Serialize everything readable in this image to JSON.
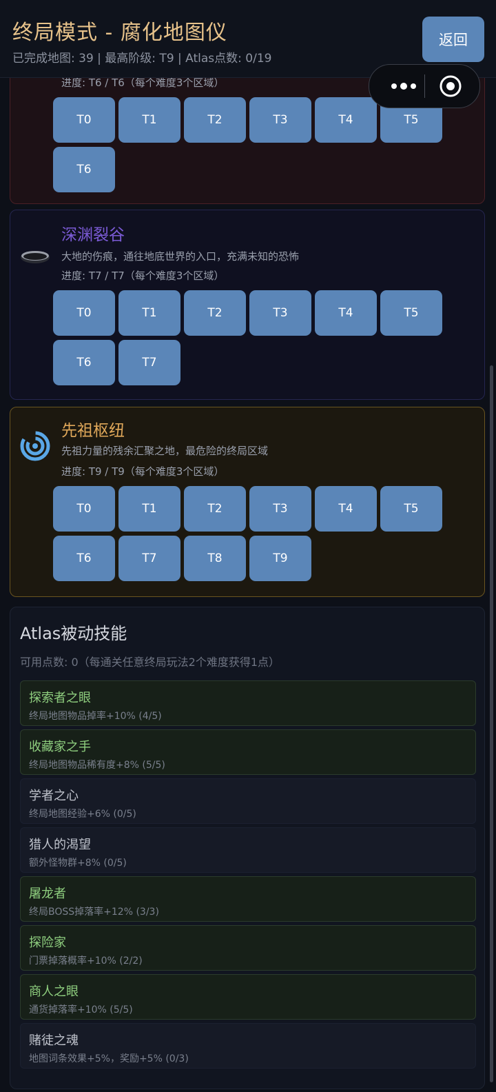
{
  "header": {
    "title": "终局模式 - 腐化地图仪",
    "subtitle": "已完成地图: 39 | 最高阶级: T9 | Atlas点数: 0/19",
    "back_label": "返回"
  },
  "regions": [
    {
      "name": "",
      "description": "",
      "progress": "进度: T6 / T6（每个难度3个区域）",
      "tiers": [
        "T0",
        "T1",
        "T2",
        "T3",
        "T4",
        "T5",
        "T6"
      ]
    },
    {
      "name": "深渊裂谷",
      "description": "大地的伤痕，通往地底世界的入口，充满未知的恐怖",
      "progress": "进度: T7 / T7（每个难度3个区域）",
      "icon": "chasm-icon",
      "tiers": [
        "T0",
        "T1",
        "T2",
        "T3",
        "T4",
        "T5",
        "T6",
        "T7"
      ]
    },
    {
      "name": "先祖枢纽",
      "description": "先祖力量的残余汇聚之地，最危险的终局区域",
      "progress": "进度: T9 / T9（每个难度3个区域）",
      "icon": "vortex-icon",
      "tiers": [
        "T0",
        "T1",
        "T2",
        "T3",
        "T4",
        "T5",
        "T6",
        "T7",
        "T8",
        "T9"
      ]
    }
  ],
  "atlas": {
    "title": "Atlas被动技能",
    "points_text": "可用点数: 0（每通关任意终局玩法2个难度获得1点）",
    "skills": [
      {
        "name": "探索者之眼",
        "desc": "终局地图物品掉率+10% (4/5)",
        "active": true
      },
      {
        "name": "收藏家之手",
        "desc": "终局地图物品稀有度+8% (5/5)",
        "active": true
      },
      {
        "name": "学者之心",
        "desc": "终局地图经验+6% (0/5)",
        "active": false
      },
      {
        "name": "猎人的渴望",
        "desc": "额外怪物群+8% (0/5)",
        "active": false
      },
      {
        "name": "屠龙者",
        "desc": "终局BOSS掉落率+12% (3/3)",
        "active": true
      },
      {
        "name": "探险家",
        "desc": "门票掉落概率+10% (2/2)",
        "active": true
      },
      {
        "name": "商人之眼",
        "desc": "通货掉落率+10% (5/5)",
        "active": true
      },
      {
        "name": "赌徒之魂",
        "desc": "地图词条效果+5%，奖励+5% (0/3)",
        "active": false
      }
    ]
  },
  "colors": {
    "accent_gold": "#e7c28a",
    "button_blue": "#5b86b8",
    "purple_title": "#7b5bd6",
    "gold_title": "#e0a85a",
    "skill_active": "#8fcf7f"
  }
}
